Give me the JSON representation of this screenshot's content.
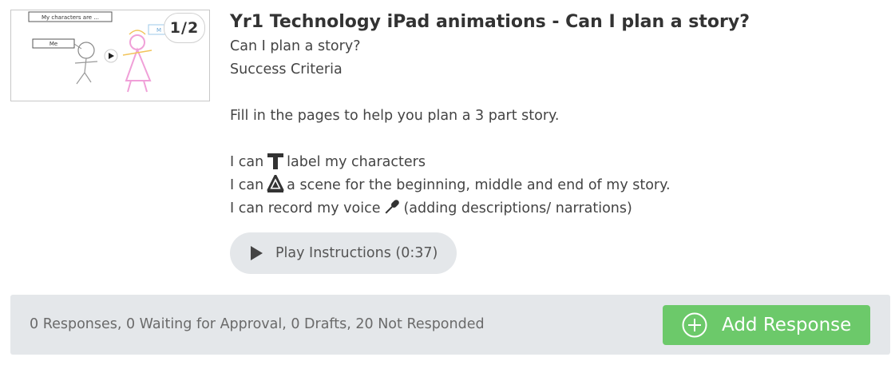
{
  "thumbnail": {
    "page_badge": "1/2",
    "caption_top": "My characters are ...",
    "caption_me": "Me",
    "caption_right": "M"
  },
  "post": {
    "title": "Yr1 Technology iPad animations - Can I plan a story?",
    "lines": [
      "Can I plan a story?",
      "Success Criteria",
      "Fill in the pages to help you plan a 3 part story."
    ],
    "criteria": [
      {
        "prefix": "I can",
        "icon": "text-tool-icon",
        "suffix": "label my characters"
      },
      {
        "prefix": "I can",
        "icon": "drawing-tool-icon",
        "suffix": "a scene for the beginning, middle and end of my story."
      },
      {
        "prefix": "I can record my voice",
        "icon": "microphone-icon",
        "suffix": "(adding descriptions/ narrations)"
      }
    ],
    "play_button_label": "Play Instructions (0:37)"
  },
  "footer": {
    "status": "0 Responses, 0 Waiting for Approval, 0 Drafts, 20 Not Responded",
    "add_button_label": "Add Response"
  },
  "colors": {
    "accent_green": "#6cc96a",
    "bar_gray": "#e4e7ea"
  }
}
